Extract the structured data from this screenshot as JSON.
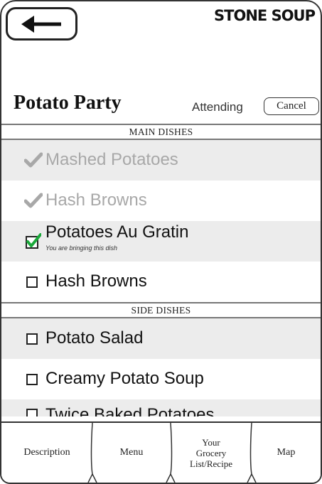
{
  "header": {
    "back_label": "Back",
    "brand": "STONE SOUP"
  },
  "event": {
    "title": "Potato Party",
    "status": "Attending",
    "cancel_label": "Cancel"
  },
  "sections": {
    "main": "MAIN DISHES",
    "side": "SIDE DISHES"
  },
  "main_items": [
    {
      "label": "Mashed Potatoes",
      "state": "taken"
    },
    {
      "label": "Hash Browns",
      "state": "taken"
    },
    {
      "label": "Potatoes Au Gratin",
      "state": "mine",
      "note": "You are bringing this dish"
    },
    {
      "label": "Hash Browns",
      "state": "open"
    }
  ],
  "side_items": [
    {
      "label": "Potato Salad",
      "state": "open"
    },
    {
      "label": "Creamy Potato Soup",
      "state": "open"
    },
    {
      "label": "Twice Baked Potatoes",
      "state": "open"
    }
  ],
  "tabs": {
    "description": "Description",
    "menu": "Menu",
    "grocery_line1": "Your",
    "grocery_line2": "Grocery",
    "grocery_line3": "List/Recipe",
    "map": "Map"
  },
  "colors": {
    "check_green": "#1aa83a",
    "disabled_gray": "#a8a8a8",
    "row_shade": "#ececec"
  }
}
